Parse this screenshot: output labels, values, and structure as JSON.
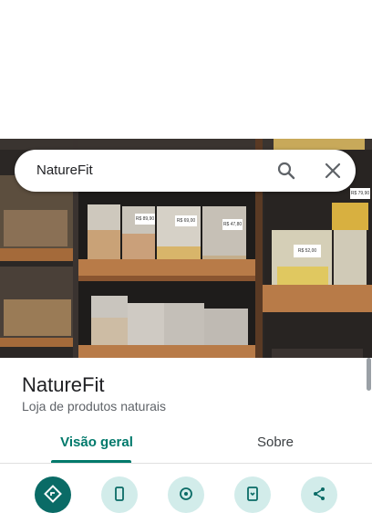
{
  "search": {
    "query": "NatureFit"
  },
  "place": {
    "name": "NatureFit",
    "category": "Loja de produtos naturais"
  },
  "tabs": [
    {
      "label": "Visão geral",
      "active": true
    },
    {
      "label": "Sobre",
      "active": false
    }
  ],
  "actions": [
    {
      "icon": "directions-icon"
    },
    {
      "icon": "phone-icon"
    },
    {
      "icon": "nearby-icon"
    },
    {
      "icon": "save-to-phone-icon"
    },
    {
      "icon": "share-icon"
    }
  ],
  "photo_labels": [
    "R$ 89,90",
    "R$ 69,00",
    "R$ 47,80",
    "R$ 52,00",
    "R$ 79,90"
  ],
  "colors": {
    "accent": "#00796b",
    "action_bg": "#d2ecea",
    "primary_action": "#0a6b66"
  }
}
